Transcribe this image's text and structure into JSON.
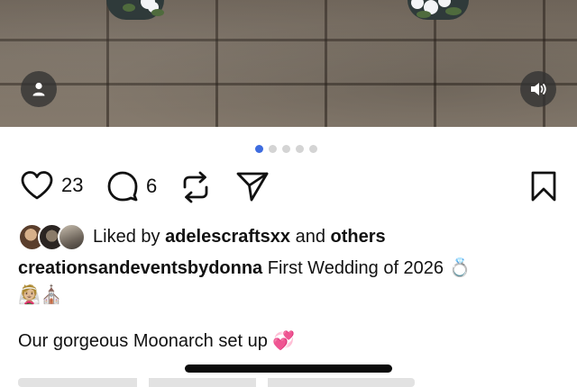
{
  "post": {
    "image_index": 1,
    "image_count": 5,
    "likes": "23",
    "comments": "6"
  },
  "liked_by": {
    "prefix": "Liked by",
    "user": "adelescraftsxx",
    "joiner": "and",
    "others": "others"
  },
  "caption": {
    "username": "creationsandeventsbydonna",
    "text": "First Wedding of 2026",
    "emoji_line1": "💍",
    "emoji_line2": "👰🏼⛪"
  },
  "extra_line": {
    "text": "Our gorgeous Moonarch set up",
    "emoji": "💞"
  },
  "colors": {
    "active_dot": "#3e6cdf",
    "inactive_dot": "#d4d4d4",
    "overlay_button": "#323232"
  },
  "icons": {
    "profile_tag": "person-icon",
    "audio": "speaker-icon",
    "like": "heart-icon",
    "comment": "comment-bubble-icon",
    "repost": "repost-icon",
    "share": "send-icon",
    "save": "bookmark-icon"
  }
}
